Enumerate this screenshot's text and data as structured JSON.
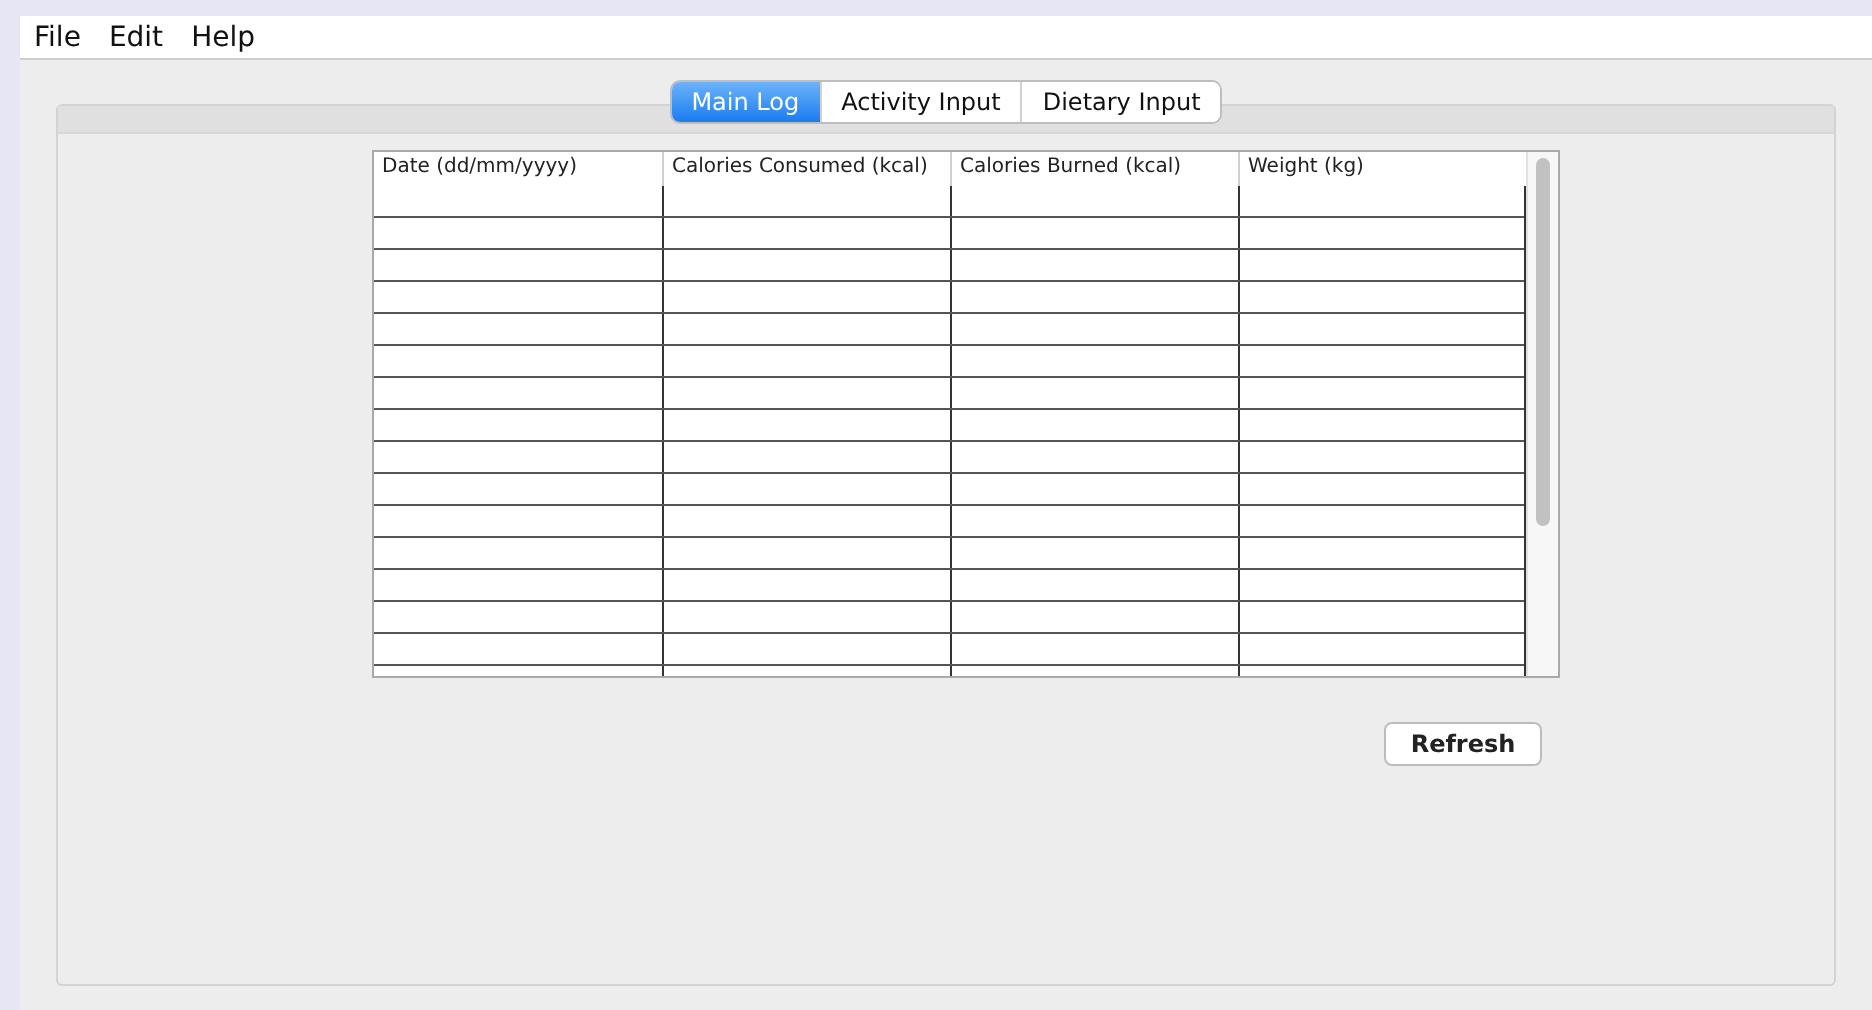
{
  "menu": [
    "File",
    "Edit",
    "Help"
  ],
  "tabs": [
    {
      "label": "Main Log",
      "selected": true
    },
    {
      "label": "Activity Input",
      "selected": false
    },
    {
      "label": "Dietary Input",
      "selected": false
    }
  ],
  "table": {
    "columns": [
      "Date (dd/mm/yyyy)",
      "Calories Consumed (kcal)",
      "Calories Burned (kcal)",
      "Weight (kg)"
    ]
  },
  "buttons": [
    "Refresh"
  ]
}
